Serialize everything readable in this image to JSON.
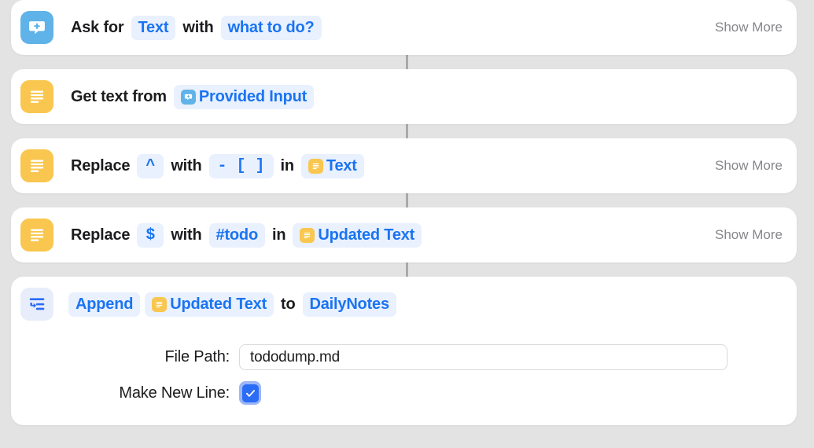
{
  "app": {
    "name": "Shortcuts Workflow Editor",
    "background_color": "#e3e3e3",
    "accent_color": "#1a74f2"
  },
  "labels": {
    "show_more": "Show More"
  },
  "actions": [
    {
      "id": "ask-for-input",
      "icon": "ask-for-input-icon",
      "icon_style": "blue",
      "has_show_more": true,
      "parts": [
        {
          "kind": "word",
          "text": "Ask for"
        },
        {
          "kind": "token",
          "text": "Text"
        },
        {
          "kind": "word",
          "text": "with"
        },
        {
          "kind": "token",
          "text": "what to do?"
        }
      ]
    },
    {
      "id": "get-text-from-input",
      "icon": "text-lines-icon",
      "icon_style": "yellow",
      "has_show_more": false,
      "parts": [
        {
          "kind": "word",
          "text": "Get text from"
        },
        {
          "kind": "token",
          "text": "Provided Input",
          "mini_icon": "ask-for-input-icon",
          "mini_icon_style": "blue"
        }
      ]
    },
    {
      "id": "replace-caret",
      "icon": "text-lines-icon",
      "icon_style": "yellow",
      "has_show_more": true,
      "parts": [
        {
          "kind": "word",
          "text": "Replace"
        },
        {
          "kind": "symbol",
          "text": "^"
        },
        {
          "kind": "word",
          "text": "with"
        },
        {
          "kind": "symbol",
          "text": "- [ ]"
        },
        {
          "kind": "word",
          "text": "in"
        },
        {
          "kind": "token",
          "text": "Text",
          "mini_icon": "text-lines-icon",
          "mini_icon_style": "yellow"
        }
      ]
    },
    {
      "id": "replace-dollar",
      "icon": "text-lines-icon",
      "icon_style": "yellow",
      "has_show_more": true,
      "parts": [
        {
          "kind": "word",
          "text": "Replace"
        },
        {
          "kind": "symbol",
          "text": "$"
        },
        {
          "kind": "word",
          "text": "with"
        },
        {
          "kind": "token",
          "text": "#todo"
        },
        {
          "kind": "word",
          "text": "in"
        },
        {
          "kind": "token",
          "text": "Updated Text",
          "mini_icon": "text-lines-icon",
          "mini_icon_style": "yellow"
        }
      ]
    },
    {
      "id": "append-to-file",
      "icon": "append-icon",
      "icon_style": "lav",
      "has_show_more": false,
      "parts": [
        {
          "kind": "token",
          "text": "Append"
        },
        {
          "kind": "token",
          "text": "Updated Text",
          "mini_icon": "text-lines-icon",
          "mini_icon_style": "yellow"
        },
        {
          "kind": "word",
          "text": "to"
        },
        {
          "kind": "token",
          "text": "DailyNotes"
        }
      ],
      "params": [
        {
          "id": "file-path",
          "label": "File Path:",
          "type": "text",
          "value": "tododump.md"
        },
        {
          "id": "make-new-line",
          "label": "Make New Line:",
          "type": "checkbox",
          "checked": true
        }
      ]
    }
  ]
}
